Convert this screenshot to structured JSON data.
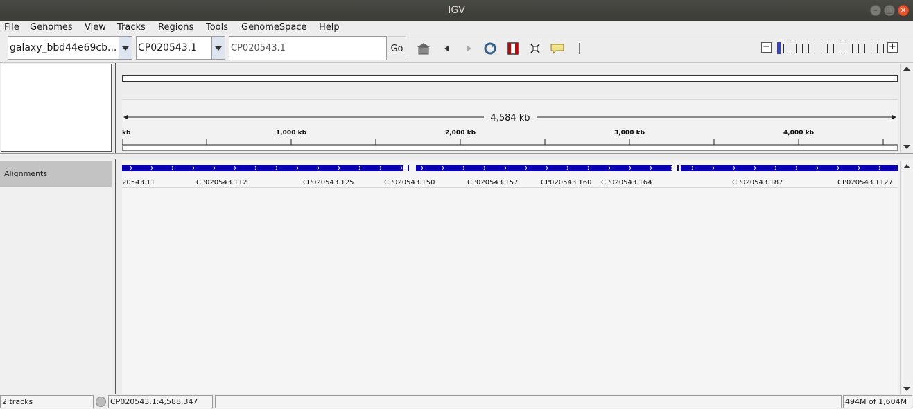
{
  "window": {
    "title": "IGV"
  },
  "menu": [
    {
      "label": "File",
      "ul": "F",
      "rest": "ile"
    },
    {
      "label": "Genomes"
    },
    {
      "label": "View",
      "ul": "V",
      "rest": "iew"
    },
    {
      "label": "Tracks"
    },
    {
      "label": "Regions"
    },
    {
      "label": "Tools"
    },
    {
      "label": "GenomeSpace"
    },
    {
      "label": "Help"
    }
  ],
  "menu_tracks": {
    "pre": "Trac",
    "ul": "k",
    "post": "s"
  },
  "toolbar": {
    "genome_value": "galaxy_bbd44e69cb...",
    "chromosome_value": "CP020543.1",
    "locus_value": "CP020543.1",
    "go_label": "Go",
    "icons": [
      "home-icon",
      "back-icon",
      "forward-icon",
      "refresh-icon",
      "region-of-interest-icon",
      "resize-icon",
      "popup-info-icon"
    ]
  },
  "zoom": {
    "minus_label": "−",
    "plus_label": "+",
    "level": 0
  },
  "ruler": {
    "span_label": "4,584 kb",
    "ticks": [
      "kb",
      "1,000 kb",
      "2,000 kb",
      "3,000 kb",
      "4,000 kb"
    ]
  },
  "tracks": [
    {
      "name": "Alignments"
    }
  ],
  "features": {
    "labels": [
      "20543.11",
      "CP020543.112",
      "CP020543.125",
      "CP020543.150",
      "CP020543.157",
      "CP020543.160",
      "CP020543.164",
      "CP020543.187",
      "CP020543.1127"
    ]
  },
  "status": {
    "tracks": "2 tracks",
    "position": "CP020543.1:4,588,347",
    "message": "",
    "memory": "494M of 1,604M"
  },
  "colors": {
    "feature": "#0a00b4",
    "zoom_selected": "#3742c9",
    "title_bar": "#3f3f3b"
  }
}
